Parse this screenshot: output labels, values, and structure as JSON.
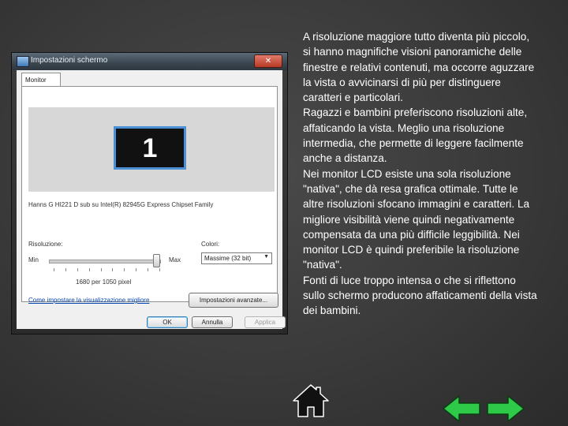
{
  "dialog": {
    "title": "Impostazioni schermo",
    "close_label": "✕",
    "tab_label": "Monitor",
    "monitor_number": "1",
    "device_text": "Hanns G HI221 D sub su Intel(R) 82945G Express Chipset Family",
    "resolution_label": "Risoluzione:",
    "min_label": "Min",
    "max_label": "Max",
    "resolution_slider_position": 0.97,
    "resolution_value": "1680 per 1050 pixel",
    "colors_label": "Colori:",
    "colors_value": "Massime (32 bit)",
    "help_link": "Come impostare la visualizzazione migliore",
    "advanced_button": "Impostazioni avanzate...",
    "ok_button": "OK",
    "cancel_button": "Annulla",
    "apply_button": "Applica"
  },
  "text": {
    "p1": "A risoluzione maggiore tutto diventa più piccolo, si hanno magnifiche visioni panoramiche delle finestre e relativi contenuti, ma occorre aguzzare la vista o avvicinarsi di più per distinguere caratteri e particolari.",
    "p2": "Ragazzi e bambini preferiscono risoluzioni alte, affaticando la vista. Meglio una risoluzione intermedia, che permette di leggere facilmente anche a distanza.",
    "p3": "Nei monitor LCD esiste una sola risoluzione \"nativa\", che dà resa grafica ottimale. Tutte le altre risoluzioni sfocano immagini e caratteri. La migliore visibilità viene quindi negativamente compensata da una più difficile leggibilità. Nei monitor LCD è quindi preferibile la risoluzione \"nativa\".",
    "p4": "Fonti di luce troppo intensa o che si riflettono sullo schermo producono affaticamenti della vista dei bambini."
  },
  "nav": {
    "home_icon": "home-icon",
    "back_icon": "arrow-left-icon",
    "forward_icon": "arrow-right-icon",
    "arrow_color": "#2fc94a"
  }
}
